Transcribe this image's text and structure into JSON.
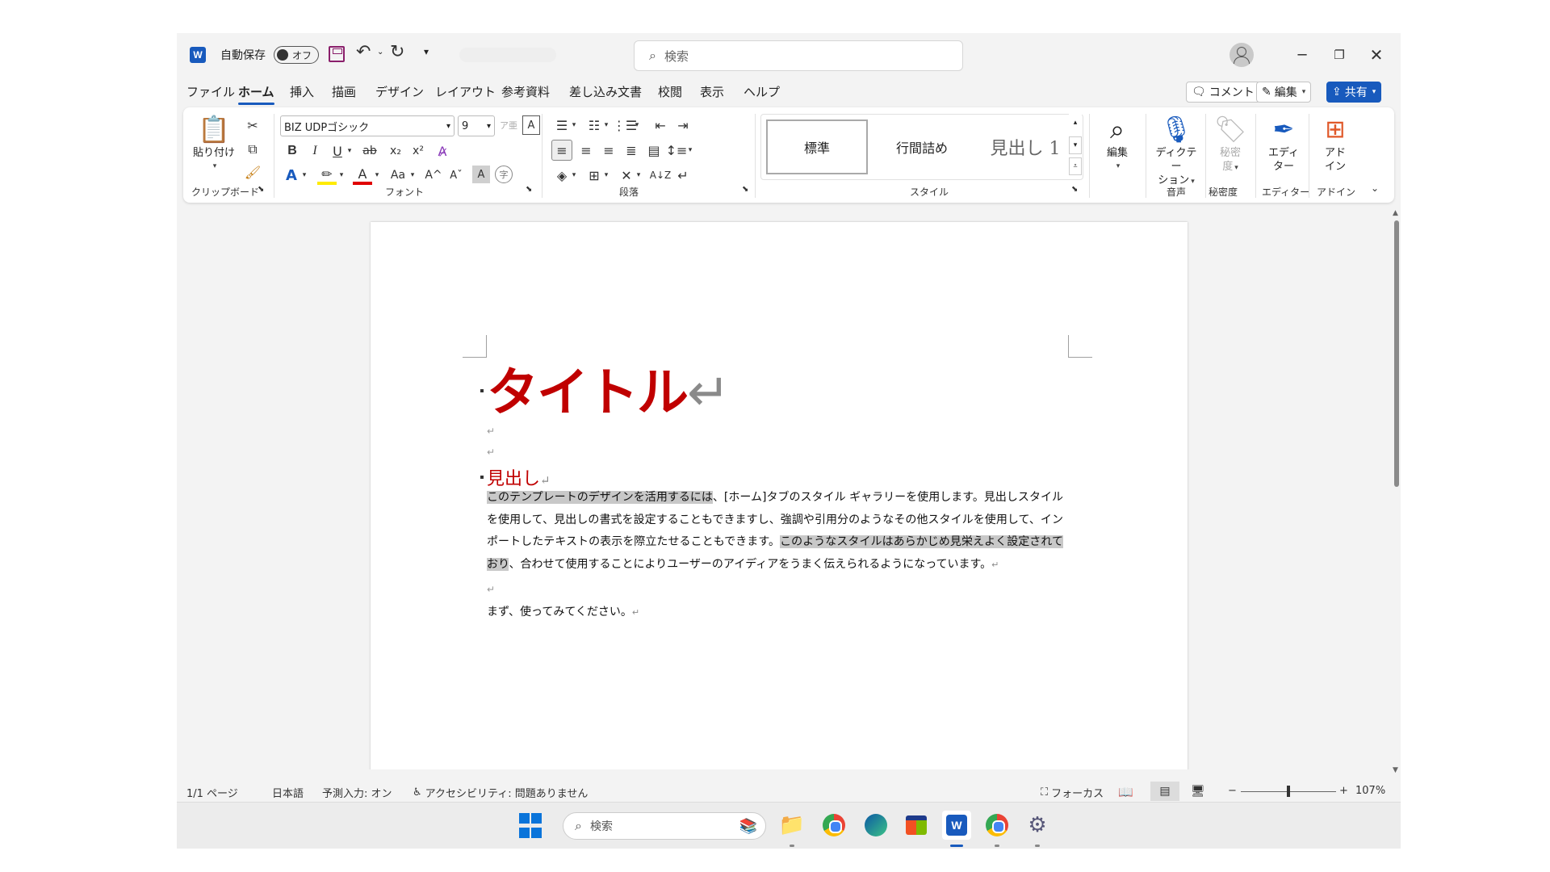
{
  "titlebar": {
    "autosave_label": "自動保存",
    "autosave_state": "オフ",
    "search_placeholder": "検索"
  },
  "menu": {
    "tabs": [
      "ファイル",
      "ホーム",
      "挿入",
      "描画",
      "デザイン",
      "レイアウト",
      "参考資料",
      "差し込み文書",
      "校閲",
      "表示",
      "ヘルプ"
    ],
    "active": "ホーム",
    "comment_label": "コメント",
    "edit_label": "編集",
    "share_label": "共有"
  },
  "ribbon": {
    "paste_label": "貼り付け",
    "clipboard_label": "クリップボード",
    "font_name": "BIZ UDPゴシック",
    "font_size": "9",
    "font_label": "フォント",
    "paragraph_label": "段落",
    "styles": [
      "標準",
      "行間詰め",
      "見出し 1"
    ],
    "styles_label": "スタイル",
    "editing_label": "編集",
    "dictate_label": "ディクテーション",
    "dictate_line1": "ディクテー",
    "dictate_line2": "ション",
    "voice_label": "音声",
    "sensitivity_line1": "秘密",
    "sensitivity_line2": "度",
    "sensitivity_group": "秘密度",
    "editor_line1": "エディ",
    "editor_line2": "ター",
    "editor_group": "エディター",
    "addin_line1": "アド",
    "addin_line2": "イン",
    "addin_group": "アドイン"
  },
  "document": {
    "title": "タイトル",
    "heading": "見出し",
    "body_hl1": "このテンプレートのデザインを活用するには",
    "body_p1": "、[ホーム]タブのスタイル ギャラリーを使用します。見出しスタイルを使用して、見出しの書式を設定することもできますし、強調や引用分のようなその他スタイルを使用して、インポートしたテキストの表示を際立たせることもできます。",
    "body_hl2": "このようなスタイルはあらかじめ見栄えよく設定されており",
    "body_p2": "、合わせて使用することによりユーザーのアイディアをうまく伝えられるようになっています。",
    "closing": "まず、使ってみてください。",
    "para_mark": "↵"
  },
  "statusbar": {
    "page": "1/1 ページ",
    "language": "日本語",
    "predictive": "予測入力: オン",
    "accessibility": "アクセシビリティ: 問題ありません",
    "focus": "フォーカス",
    "zoom_minus": "−",
    "zoom_plus": "+",
    "zoom": "107%",
    "zoom_fraction": 0.5
  },
  "taskbar": {
    "search_placeholder": "検索"
  },
  "colors": {
    "accent": "#185abd",
    "title_red": "#c00000"
  }
}
